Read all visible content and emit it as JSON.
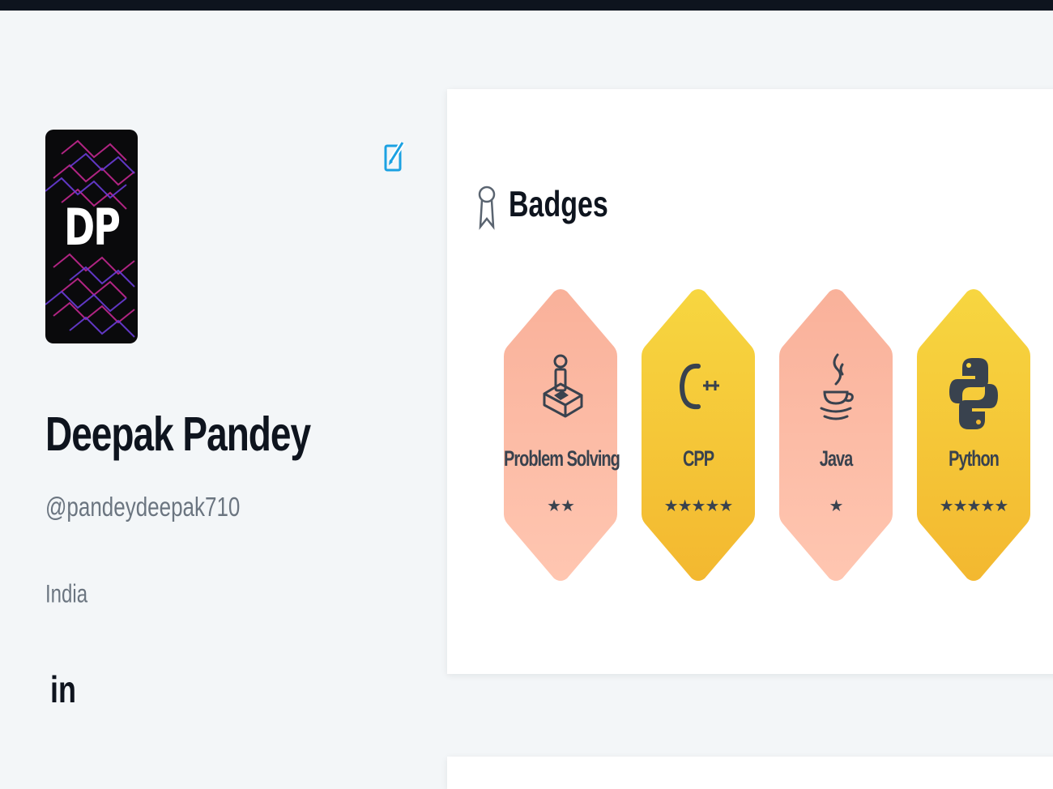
{
  "profile": {
    "avatar_initials": "DP",
    "name": "Deepak Pandey",
    "username": "@pandeydeepak710",
    "country": "India",
    "linkedin_label": "in"
  },
  "badges_card": {
    "title": "Badges",
    "items": [
      {
        "label": "Problem Solving",
        "stars": "★★",
        "star_count": 2,
        "color": "bronze",
        "icon": "joystick-icon"
      },
      {
        "label": "CPP",
        "stars": "★★★★★",
        "star_count": 5,
        "color": "gold",
        "icon": "cpp-icon"
      },
      {
        "label": "Java",
        "stars": "★",
        "star_count": 1,
        "color": "bronze",
        "icon": "java-cup-icon"
      },
      {
        "label": "Python",
        "stars": "★★★★★",
        "star_count": 5,
        "color": "gold",
        "icon": "python-icon"
      }
    ]
  },
  "colors": {
    "bronze_top": "#f9b19a",
    "bronze_bottom": "#ffc6b1",
    "gold_top": "#f7d640",
    "gold_bottom": "#f3b830",
    "link_blue": "#1ba1e2",
    "text_dark": "#0e141e",
    "text_muted": "#6b7580"
  }
}
